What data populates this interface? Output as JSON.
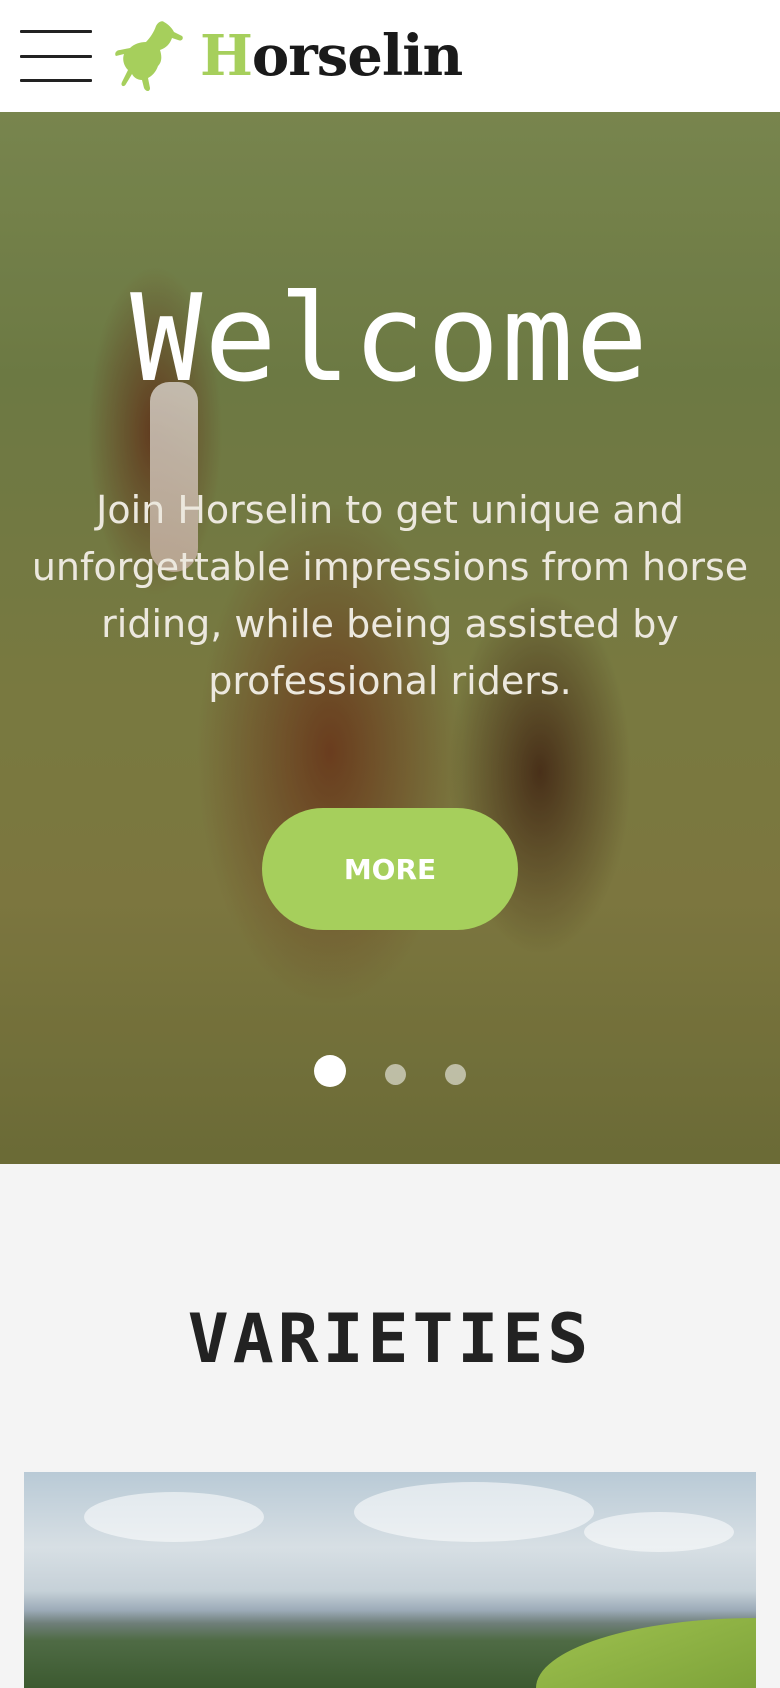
{
  "header": {
    "menu_icon": "hamburger-menu-icon",
    "logo_icon": "rearing-horse-icon",
    "brand_first_letter": "H",
    "brand_rest": "orselin",
    "brand_accent_color": "#a6cf5c"
  },
  "hero": {
    "title": "Welcome",
    "text": "Join Horselin to get unique and unforgettable impressions from horse riding, while being assisted by professional riders.",
    "button_label": "MORE",
    "button_color": "#a6cf5c",
    "slides_total": 3,
    "active_slide": 1
  },
  "varieties": {
    "title": "VARIETIES"
  }
}
